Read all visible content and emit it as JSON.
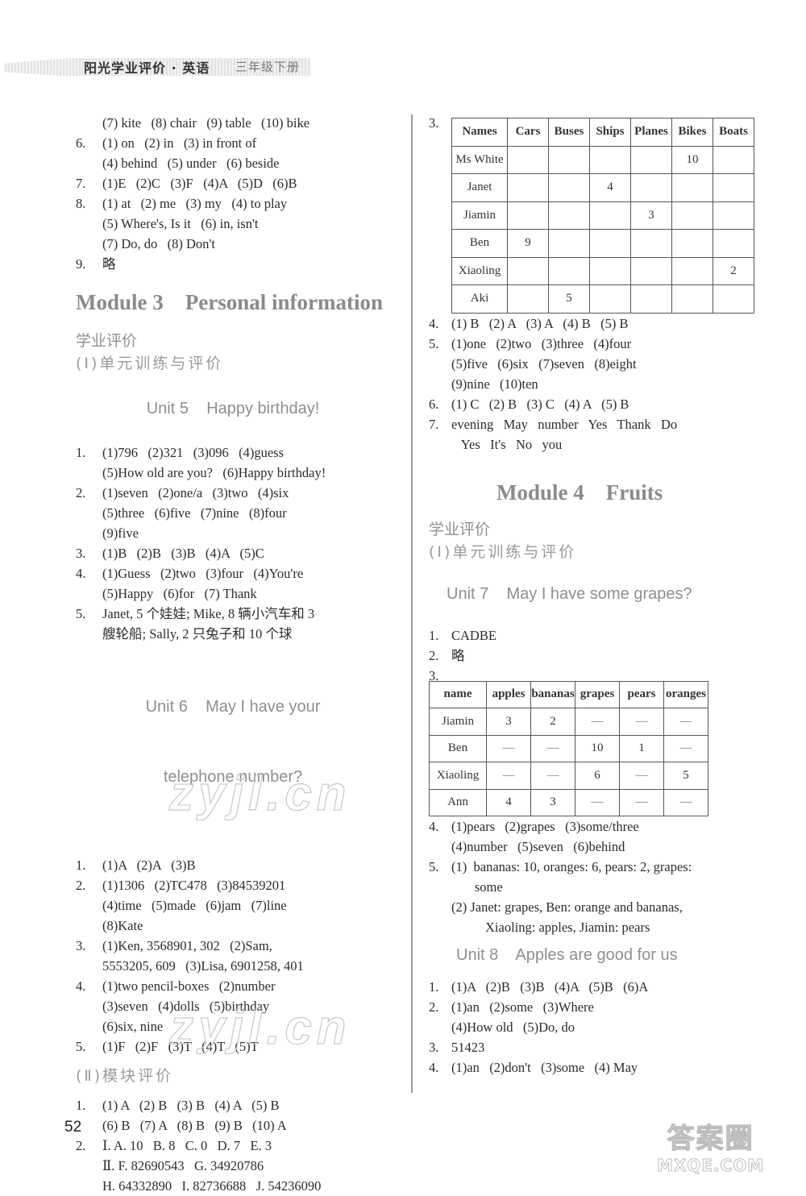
{
  "header": {
    "title": "阳光学业评价 · 英语",
    "grade": "三年级下册"
  },
  "page_number": "52",
  "left": {
    "pre_items": [
      {
        "num": "",
        "text": "(7) kite   (8) chair   (9) table   (10) bike"
      },
      {
        "num": "6.",
        "text": "(1) on   (2) in   (3) in front of"
      },
      {
        "num": "",
        "text": "(4) behind   (5) under   (6) beside"
      },
      {
        "num": "7.",
        "text": "(1)E   (2)C   (3)F   (4)A   (5)D   (6)B"
      },
      {
        "num": "8.",
        "text": "(1) at   (2) me   (3) my   (4) to play"
      },
      {
        "num": "",
        "text": "(5) Where's, Is it   (6) in, isn't"
      },
      {
        "num": "",
        "text": "(7) Do, do   (8) Don't"
      },
      {
        "num": "9.",
        "text": "略"
      }
    ],
    "module3": {
      "title": "Module 3    Personal information",
      "section": "学业评价",
      "subsection": "(Ⅰ)单元训练与评价",
      "unit5": {
        "title": "Unit 5    Happy birthday!",
        "items": [
          {
            "num": "1.",
            "text": "(1)796   (2)321   (3)096   (4)guess"
          },
          {
            "num": "",
            "text": "(5)How old are you?   (6)Happy birthday!"
          },
          {
            "num": "2.",
            "text": "(1)seven   (2)one/a   (3)two   (4)six"
          },
          {
            "num": "",
            "text": "(5)three   (6)five   (7)nine   (8)four"
          },
          {
            "num": "",
            "text": "(9)five"
          },
          {
            "num": "3.",
            "text": "(1)B   (2)B   (3)B   (4)A   (5)C"
          },
          {
            "num": "4.",
            "text": "(1)Guess   (2)two   (3)four   (4)You're"
          },
          {
            "num": "",
            "text": "(5)Happy   (6)for   (7) Thank"
          },
          {
            "num": "5.",
            "text": "Janet, 5 个娃娃; Mike, 8 辆小汽车和 3"
          },
          {
            "num": "",
            "text": "艘轮船; Sally, 2 只兔子和 10 个球"
          }
        ]
      },
      "unit6": {
        "title_line1": "Unit 6    May I have your",
        "title_line2": "telephone number?",
        "items": [
          {
            "num": "1.",
            "text": "(1)A   (2)A   (3)B"
          },
          {
            "num": "2.",
            "text": "(1)1306   (2)TC478   (3)84539201"
          },
          {
            "num": "",
            "text": "(4)time   (5)made   (6)jam   (7)line"
          },
          {
            "num": "",
            "text": "(8)Kate"
          },
          {
            "num": "3.",
            "text": "(1)Ken, 3568901, 302   (2)Sam,"
          },
          {
            "num": "",
            "text": "5553205, 609   (3)Lisa, 6901258, 401"
          },
          {
            "num": "4.",
            "text": "(1)two pencil-boxes   (2)number"
          },
          {
            "num": "",
            "text": "(3)seven   (4)dolls   (5)birthday"
          },
          {
            "num": "",
            "text": "(6)six, nine"
          },
          {
            "num": "5.",
            "text": "(1)F   (2)F   (3)T   (4)T   (5)T"
          }
        ]
      },
      "module_eval": {
        "subsection": "(Ⅱ)模块评价",
        "items": [
          {
            "num": "1.",
            "text": "(1) A   (2) B   (3) B   (4) A   (5) B"
          },
          {
            "num": "",
            "text": "(6) B   (7) A   (8) B   (9) B   (10) A"
          },
          {
            "num": "2.",
            "text": "Ⅰ. A. 10   B. 8   C. 0   D. 7   E. 3"
          },
          {
            "num": "",
            "text": "Ⅱ. F. 82690543   G. 34920786"
          },
          {
            "num": "",
            "text": "H. 64332890   I. 82736688   J. 54236090"
          }
        ]
      }
    }
  },
  "right": {
    "q3_num": "3.",
    "vehicles_table": {
      "headers": [
        "Names",
        "Cars",
        "Buses",
        "Ships",
        "Planes",
        "Bikes",
        "Boats"
      ],
      "rows": [
        [
          "Ms White",
          "",
          "",
          "",
          "",
          "10",
          ""
        ],
        [
          "Janet",
          "",
          "",
          "4",
          "",
          "",
          ""
        ],
        [
          "Jiamin",
          "",
          "",
          "",
          "3",
          "",
          ""
        ],
        [
          "Ben",
          "9",
          "",
          "",
          "",
          "",
          ""
        ],
        [
          "Xiaoling",
          "",
          "",
          "",
          "",
          "",
          "2"
        ],
        [
          "Aki",
          "",
          "5",
          "",
          "",
          "",
          ""
        ]
      ]
    },
    "post_table_items": [
      {
        "num": "4.",
        "text": "(1) B   (2) A   (3) A   (4) B   (5) B"
      },
      {
        "num": "5.",
        "text": "(1)one   (2)two   (3)three   (4)four"
      },
      {
        "num": "",
        "text": "(5)five   (6)six   (7)seven   (8)eight"
      },
      {
        "num": "",
        "text": "(9)nine   (10)ten"
      },
      {
        "num": "6.",
        "text": "(1) C   (2) B   (3) C   (4) A   (5) B"
      },
      {
        "num": "7.",
        "text": "evening   May   number   Yes   Thank   Do"
      },
      {
        "num": "",
        "text": "   Yes   It's   No   you"
      }
    ],
    "module4": {
      "title": "Module 4    Fruits",
      "section": "学业评价",
      "subsection": "(Ⅰ)单元训练与评价",
      "unit7": {
        "title": "Unit 7    May I have some grapes?",
        "items_before": [
          {
            "num": "1.",
            "text": "CADBE"
          },
          {
            "num": "2.",
            "text": "略"
          },
          {
            "num": "3.",
            "text": ""
          }
        ],
        "fruit_table": {
          "headers": [
            "name",
            "apples",
            "bananas",
            "grapes",
            "pears",
            "oranges"
          ],
          "rows": [
            [
              "Jiamin",
              "3",
              "2",
              "—",
              "—",
              "—"
            ],
            [
              "Ben",
              "—",
              "—",
              "10",
              "1",
              "—"
            ],
            [
              "Xiaoling",
              "—",
              "—",
              "6",
              "—",
              "5"
            ],
            [
              "Ann",
              "4",
              "3",
              "—",
              "—",
              "—"
            ]
          ]
        },
        "items_after": [
          {
            "num": "4.",
            "text": "(1)pears   (2)grapes   (3)some/three"
          },
          {
            "num": "",
            "text": "(4)number   (5)seven   (6)behind"
          },
          {
            "num": "5.",
            "text": "(1)  bananas: 10, oranges: 6, pears: 2, grapes:"
          },
          {
            "num": "",
            "text": "       some",
            "indent": 2
          },
          {
            "num": "",
            "text": "(2) Janet: grapes, Ben: orange and bananas,"
          },
          {
            "num": "",
            "text": "Xiaoling: apples, Jiamin: pears",
            "indent": 2
          }
        ]
      },
      "unit8": {
        "title": "Unit 8    Apples are good for us",
        "items": [
          {
            "num": "1.",
            "text": "(1)A   (2)B   (3)B   (4)A   (5)B   (6)A"
          },
          {
            "num": "2.",
            "text": "(1)an   (2)some   (3)Where"
          },
          {
            "num": "",
            "text": "(4)How old   (5)Do, do"
          },
          {
            "num": "3.",
            "text": "51423"
          },
          {
            "num": "4.",
            "text": "(1)an   (2)don't   (3)some   (4) May"
          }
        ]
      }
    }
  },
  "watermarks": {
    "inline": "zyjl.cn",
    "footer_zh": "答案圈",
    "footer_en": "MXQE.COM"
  }
}
